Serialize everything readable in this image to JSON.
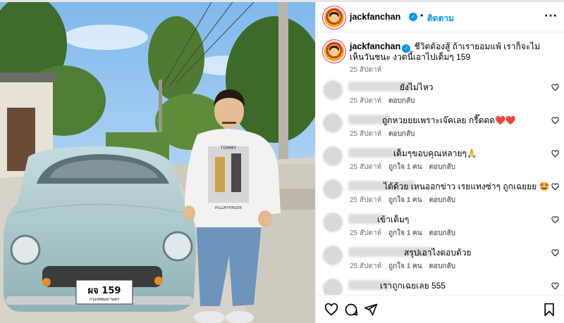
{
  "post": {
    "username": "jackfanchan",
    "follow_label": "ติดตาม",
    "separator": "•",
    "more_label": "···",
    "caption_text": "ชีวิตต้องสู้ ถ้าเรายอมแพ้ เราก็จะไม่เห็นวันชนะ งวดนี้เอาไปเต็มๆ 159",
    "caption_time": "25 สัปดาห์"
  },
  "photo": {
    "plate_text": "ผจ 159",
    "plate_province": "กรุงเทพมหานคร",
    "shirt_top": "TOMMY",
    "shirt_bottom": "PULLMYFINGER",
    "colors": {
      "sky": "#a9d3f5",
      "car": "#a9c9cc",
      "shirt": "#f4f4f4",
      "jeans": "#6b8fb5"
    }
  },
  "comments": [
    {
      "text": "ยังไม่ไหว",
      "time": "25 สัปดาห์",
      "likes": "",
      "reply": "ตอบกลับ",
      "text_x": 566
    },
    {
      "text": "ถูกหวยยยเพราะเจ๊คเลย กรี๊ดดด❤️❤️",
      "time": "25 สัปดาห์",
      "likes": "",
      "reply": "ตอบกลับ",
      "text_x": 541
    },
    {
      "text": "เต็มๆขอบคุณหลายๆ🙏",
      "time": "25 สัปดาห์",
      "likes": "ถูกใจ 1 คน",
      "reply": "ตอบกลับ",
      "text_x": 557
    },
    {
      "text": "ได้ด้วย เหนออกข่าว เรยแทงซ่าๆ ถูกเฉยยย 🤩",
      "time": "25 สัปดาห์",
      "likes": "ถูกใจ 1 คน",
      "reply": "ตอบกลับ",
      "text_x": 543
    },
    {
      "text": "เข้าเต็มๆ",
      "time": "25 สัปดาห์",
      "likes": "ถูกใจ 1 คน",
      "reply": "ตอบกลับ",
      "text_x": 534
    },
    {
      "text": "สรุปเอาไงตอบด้วย",
      "time": "25 สัปดาห์",
      "likes": "ถูกใจ 1 คน",
      "reply": "ตอบกลับ",
      "text_x": 572
    },
    {
      "text": "เราถูกเฉยเลย 555",
      "time": "",
      "likes": "",
      "reply": "",
      "text_x": 538
    }
  ],
  "icons": {
    "verified": "verified-badge-icon",
    "like": "heart-icon",
    "comment": "comment-bubble-icon",
    "share": "paper-plane-icon",
    "save": "bookmark-icon"
  },
  "verified_glyph": "✓"
}
